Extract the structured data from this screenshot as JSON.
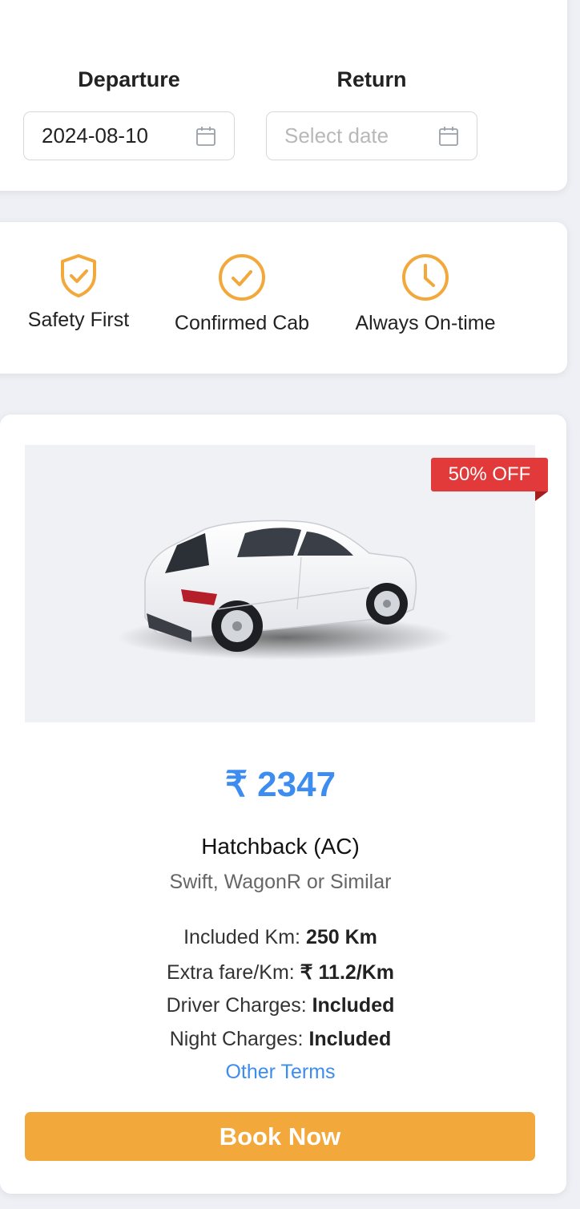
{
  "trip": {
    "departure_label": "Departure",
    "departure_value": "2024-08-10",
    "return_label": "Return",
    "return_placeholder": "Select date",
    "calendar_icon": "calendar-icon"
  },
  "features": [
    {
      "label": "Safety First",
      "icon": "shield-check-icon"
    },
    {
      "label": "Confirmed Cab",
      "icon": "check-circle-icon"
    },
    {
      "label": "Always On-time",
      "icon": "clock-icon"
    }
  ],
  "cab": {
    "discount_badge": "50% OFF",
    "price": "₹ 2347",
    "name": "Hatchback (AC)",
    "models": "Swift, WagonR or Similar",
    "specs": [
      {
        "label": "Included Km: ",
        "value": "250 Km"
      },
      {
        "label": "Extra fare/Km: ",
        "value": "₹ 11.2/Km"
      },
      {
        "label": "Driver Charges: ",
        "value": "Included"
      },
      {
        "label": "Night Charges: ",
        "value": "Included"
      }
    ],
    "terms_link": "Other Terms",
    "book_button": "Book Now"
  },
  "colors": {
    "accent": "#f2a83b",
    "price_blue": "#3d8cf0",
    "badge_red": "#e23a3a",
    "background": "#eef0f5"
  }
}
